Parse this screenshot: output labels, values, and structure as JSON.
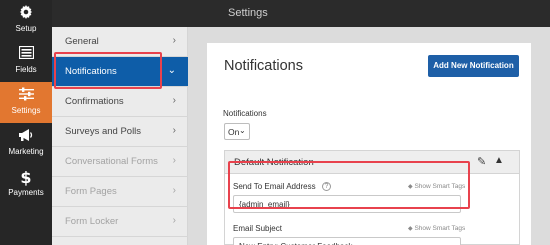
{
  "rail": {
    "items": [
      {
        "label": "Setup",
        "icon": "gear-icon"
      },
      {
        "label": "Fields",
        "icon": "fields-icon"
      },
      {
        "label": "Settings",
        "icon": "sliders-icon"
      },
      {
        "label": "Marketing",
        "icon": "megaphone-icon"
      },
      {
        "label": "Payments",
        "icon": "dollar-icon"
      }
    ],
    "active_color": "#e27730"
  },
  "header": {
    "title": "Settings"
  },
  "subnav": {
    "items": [
      {
        "label": "General"
      },
      {
        "label": "Notifications"
      },
      {
        "label": "Confirmations"
      },
      {
        "label": "Surveys and Polls"
      },
      {
        "label": "Conversational Forms"
      },
      {
        "label": "Form Pages"
      },
      {
        "label": "Form Locker"
      }
    ],
    "active_color": "#0e5da8",
    "highlight_color": "#e8424d"
  },
  "main": {
    "title": "Notifications",
    "add_button": "Add New Notification",
    "notifications_label": "Notifications",
    "notifications_value": "On",
    "card": {
      "title": "Default Notification",
      "fields": [
        {
          "label": "Send To Email Address",
          "smart_tags": "Show Smart Tags",
          "value": "{admin_email}"
        },
        {
          "label": "Email Subject",
          "smart_tags": "Show Smart Tags",
          "value": "New Entry: Customer Feedback"
        }
      ]
    }
  }
}
